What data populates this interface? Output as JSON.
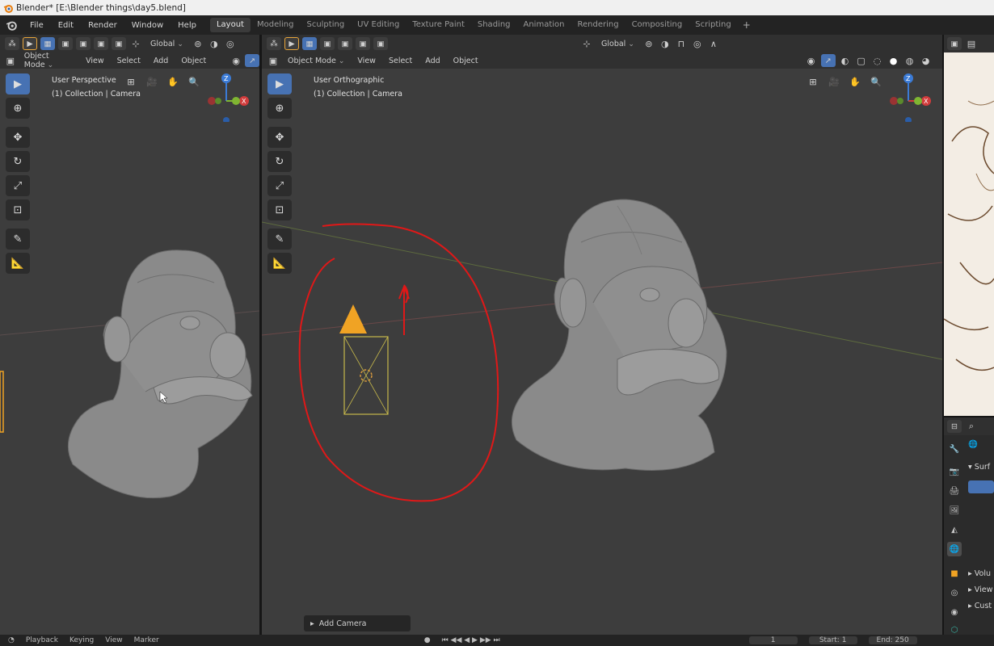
{
  "window": {
    "title": "Blender* [E:\\Blender things\\day5.blend]"
  },
  "menu": [
    "File",
    "Edit",
    "Render",
    "Window",
    "Help"
  ],
  "workspaces": [
    "Layout",
    "Modeling",
    "Sculpting",
    "UV Editing",
    "Texture Paint",
    "Shading",
    "Animation",
    "Rendering",
    "Compositing",
    "Scripting"
  ],
  "workspace_add": "+",
  "left_viewport": {
    "orientation": "Global",
    "mode": "Object Mode",
    "menus": [
      "View",
      "Select",
      "Add",
      "Object"
    ],
    "view_name": "User Perspective",
    "collection": "(1) Collection | Camera"
  },
  "right_viewport": {
    "orientation": "Global",
    "mode": "Object Mode",
    "menus": [
      "View",
      "Select",
      "Add",
      "Object"
    ],
    "view_name": "User Orthographic",
    "collection": "(1) Collection | Camera",
    "redo_panel": "Add Camera"
  },
  "properties": {
    "items": [
      "Surf",
      "Volu",
      "View",
      "Cust"
    ]
  },
  "timeline": {
    "menus": [
      "Playback",
      "Keying",
      "View",
      "Marker"
    ],
    "current_frame": "1",
    "start_label": "Start:",
    "start": "1",
    "end_label": "End:",
    "end": "250"
  },
  "colors": {
    "accent": "#4772b3",
    "camera": "#f0a324",
    "annotation": "#e01818",
    "viewport_bg": "#3d3d3d"
  },
  "icons": [
    "blender-logo",
    "select-box-icon",
    "cursor-icon",
    "move-icon",
    "rotate-icon",
    "scale-icon",
    "transform-icon",
    "annotate-icon",
    "measure-icon",
    "grid-icon",
    "camera-view-icon",
    "hand-pan-icon",
    "zoom-icon"
  ]
}
